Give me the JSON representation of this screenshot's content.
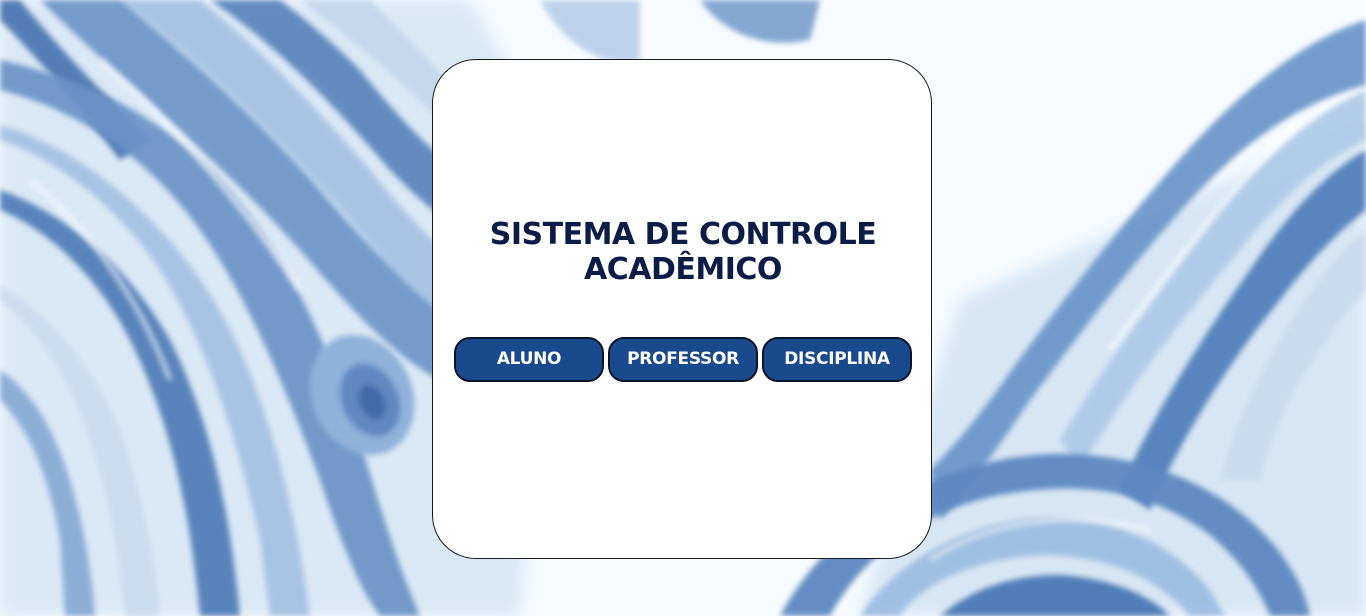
{
  "app": {
    "title": "SISTEMA DE CONTROLE ACADÊMICO"
  },
  "menu": {
    "buttons": [
      {
        "label": "ALUNO"
      },
      {
        "label": "PROFESSOR"
      },
      {
        "label": "DISCIPLINA"
      }
    ]
  },
  "colors": {
    "title": "#0b1d47",
    "button_bg": "#1a4a8e",
    "button_text": "#ffffff",
    "card_bg": "#ffffff",
    "background_accent": "#3f6fae"
  }
}
